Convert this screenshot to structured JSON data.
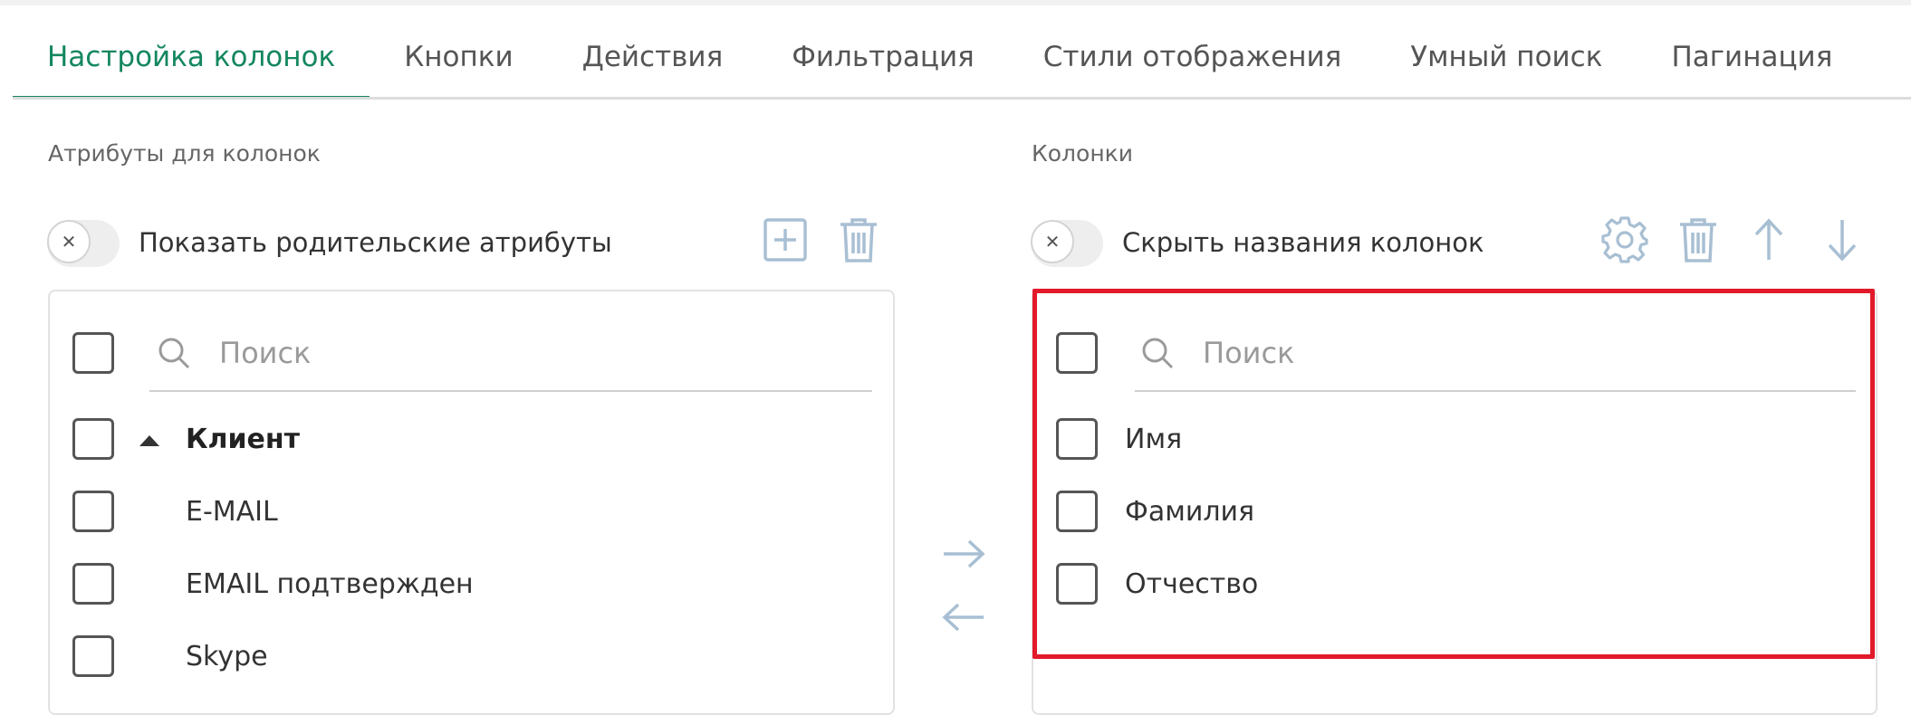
{
  "tabs": [
    {
      "label": "Настройка колонок",
      "active": true
    },
    {
      "label": "Кнопки"
    },
    {
      "label": "Действия"
    },
    {
      "label": "Фильтрация"
    },
    {
      "label": "Стили отображения"
    },
    {
      "label": "Умный поиск"
    },
    {
      "label": "Пагинация"
    }
  ],
  "left": {
    "title": "Атрибуты для колонок",
    "toggle_label": "Показать родительские атрибуты",
    "search_placeholder": "Поиск",
    "group_label": "Клиент",
    "items": [
      "E-MAIL",
      "EMAIL подтвержден",
      "Skype"
    ]
  },
  "right": {
    "title": "Колонки",
    "toggle_label": "Скрыть названия колонок",
    "search_placeholder": "Поиск",
    "items": [
      "Имя",
      "Фамилия",
      "Отчество"
    ]
  },
  "colors": {
    "accent": "#14875e",
    "highlight": "#e21a2a",
    "icon": "#a8bfd3"
  }
}
